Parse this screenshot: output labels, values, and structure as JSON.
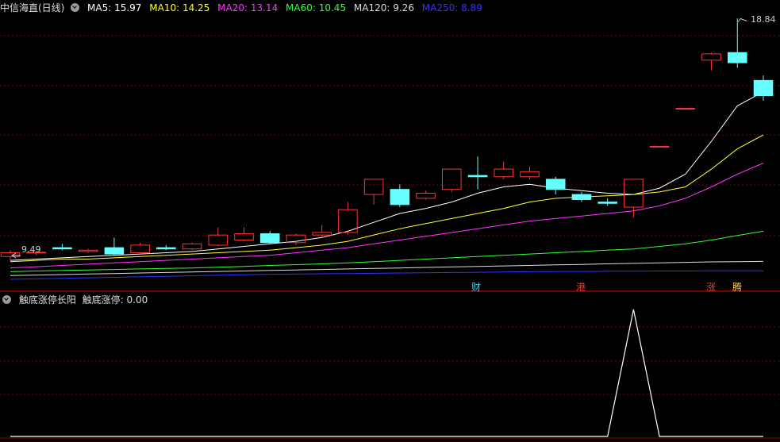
{
  "header": {
    "stock_name": "中信海直(日线)",
    "ma_labels": [
      {
        "text": "MA5: 15.97",
        "color": "#ffffff"
      },
      {
        "text": "MA10: 14.25",
        "color": "#ffff33"
      },
      {
        "text": "MA20: 13.14",
        "color": "#ff33ff"
      },
      {
        "text": "MA60: 10.45",
        "color": "#33ff33"
      },
      {
        "text": "MA120: 9.26",
        "color": "#dddddd"
      },
      {
        "text": "MA250: 8.89",
        "color": "#3333ff"
      }
    ]
  },
  "indicator_header": {
    "title": "触底涨停长阳",
    "value_label": "触底涨停: 0.00"
  },
  "price_labels": {
    "high": "18.84",
    "low": "9.49"
  },
  "event_tags": [
    {
      "text": "财",
      "color": "#33ccff"
    },
    {
      "text": "港",
      "color": "#ff3333"
    },
    {
      "text": "涨",
      "color": "#ff3333"
    },
    {
      "text": "腾",
      "color": "#ffcc66"
    }
  ],
  "colors": {
    "up": "#ff3333",
    "down": "#66ffff",
    "grid": "#7a0000"
  },
  "chart_data": [
    {
      "type": "candlestick",
      "ylim": [
        8.3,
        19.2
      ],
      "candles": [
        {
          "o": 9.45,
          "h": 9.7,
          "l": 9.3,
          "c": 9.6
        },
        {
          "o": 9.6,
          "h": 9.65,
          "l": 9.5,
          "c": 9.62
        },
        {
          "o": 9.8,
          "h": 9.95,
          "l": 9.7,
          "c": 9.75
        },
        {
          "o": 9.65,
          "h": 9.75,
          "l": 9.6,
          "c": 9.7
        },
        {
          "o": 9.8,
          "h": 10.2,
          "l": 9.5,
          "c": 9.55
        },
        {
          "o": 9.6,
          "h": 10.0,
          "l": 9.55,
          "c": 9.9
        },
        {
          "o": 9.8,
          "h": 9.9,
          "l": 9.7,
          "c": 9.75
        },
        {
          "o": 9.75,
          "h": 10.0,
          "l": 9.7,
          "c": 9.95
        },
        {
          "o": 9.9,
          "h": 10.6,
          "l": 9.85,
          "c": 10.3
        },
        {
          "o": 10.1,
          "h": 10.6,
          "l": 10.05,
          "c": 10.35
        },
        {
          "o": 10.35,
          "h": 10.45,
          "l": 9.95,
          "c": 10.0
        },
        {
          "o": 10.0,
          "h": 10.35,
          "l": 9.9,
          "c": 10.3
        },
        {
          "o": 10.3,
          "h": 10.7,
          "l": 10.2,
          "c": 10.4
        },
        {
          "o": 10.4,
          "h": 11.6,
          "l": 10.3,
          "c": 11.3
        },
        {
          "o": 11.9,
          "h": 12.0,
          "l": 11.5,
          "c": 12.5
        },
        {
          "o": 12.1,
          "h": 12.3,
          "l": 11.4,
          "c": 11.5
        },
        {
          "o": 11.75,
          "h": 12.05,
          "l": 11.7,
          "c": 11.95
        },
        {
          "o": 12.1,
          "h": 12.9,
          "l": 12.0,
          "c": 12.9
        },
        {
          "o": 12.65,
          "h": 13.4,
          "l": 12.1,
          "c": 12.6
        },
        {
          "o": 12.6,
          "h": 13.2,
          "l": 12.5,
          "c": 12.9
        },
        {
          "o": 12.6,
          "h": 13.0,
          "l": 12.5,
          "c": 12.8
        },
        {
          "o": 12.5,
          "h": 12.6,
          "l": 11.9,
          "c": 12.1
        },
        {
          "o": 11.9,
          "h": 12.0,
          "l": 11.6,
          "c": 11.7
        },
        {
          "o": 11.6,
          "h": 11.75,
          "l": 11.45,
          "c": 11.55
        },
        {
          "o": 11.4,
          "h": 11.3,
          "l": 11.0,
          "c": 12.5
        },
        {
          "o": 13.8,
          "h": 13.8,
          "l": 13.8,
          "c": 13.8
        },
        {
          "o": 15.3,
          "h": 15.3,
          "l": 15.3,
          "c": 15.3
        },
        {
          "o": 17.2,
          "h": 17.5,
          "l": 16.8,
          "c": 17.45
        },
        {
          "o": 17.5,
          "h": 18.85,
          "l": 16.9,
          "c": 17.1
        },
        {
          "o": 16.4,
          "h": 16.6,
          "l": 15.6,
          "c": 15.8
        }
      ],
      "moving_averages": [
        {
          "name": "MA5",
          "color": "#ffffff",
          "values": [
            9.3,
            9.35,
            9.4,
            9.45,
            9.5,
            9.55,
            9.6,
            9.65,
            9.75,
            9.85,
            9.95,
            10.05,
            10.2,
            10.45,
            10.8,
            11.15,
            11.35,
            11.6,
            11.95,
            12.2,
            12.3,
            12.15,
            12.05,
            11.95,
            11.9,
            12.15,
            12.7,
            14.0,
            15.4,
            15.95
          ]
        },
        {
          "name": "MA10",
          "color": "#ffff33",
          "values": [
            9.25,
            9.3,
            9.35,
            9.35,
            9.4,
            9.45,
            9.5,
            9.55,
            9.6,
            9.65,
            9.7,
            9.8,
            9.9,
            10.05,
            10.3,
            10.55,
            10.75,
            10.95,
            11.15,
            11.35,
            11.6,
            11.75,
            11.8,
            11.85,
            11.9,
            12.0,
            12.2,
            12.9,
            13.7,
            14.25
          ]
        },
        {
          "name": "MA20",
          "color": "#ff33ff",
          "values": [
            9.0,
            9.05,
            9.1,
            9.15,
            9.2,
            9.25,
            9.3,
            9.35,
            9.4,
            9.45,
            9.5,
            9.6,
            9.7,
            9.8,
            9.95,
            10.1,
            10.25,
            10.4,
            10.55,
            10.7,
            10.85,
            10.95,
            11.05,
            11.15,
            11.25,
            11.45,
            11.75,
            12.2,
            12.7,
            13.14
          ]
        },
        {
          "name": "MA60",
          "color": "#33ff33",
          "values": [
            8.85,
            8.88,
            8.9,
            8.92,
            8.94,
            8.96,
            8.98,
            9.0,
            9.03,
            9.06,
            9.1,
            9.13,
            9.16,
            9.2,
            9.25,
            9.3,
            9.35,
            9.4,
            9.45,
            9.5,
            9.55,
            9.6,
            9.65,
            9.7,
            9.75,
            9.85,
            9.95,
            10.1,
            10.28,
            10.45
          ]
        },
        {
          "name": "MA120",
          "color": "#dddddd",
          "values": [
            8.7,
            8.72,
            8.74,
            8.76,
            8.78,
            8.8,
            8.82,
            8.84,
            8.86,
            8.88,
            8.9,
            8.92,
            8.94,
            8.96,
            8.98,
            9.0,
            9.02,
            9.04,
            9.06,
            9.08,
            9.1,
            9.12,
            9.14,
            9.16,
            9.18,
            9.2,
            9.22,
            9.24,
            9.25,
            9.26
          ]
        },
        {
          "name": "MA250",
          "color": "#3333ff",
          "values": [
            8.55,
            8.57,
            8.59,
            8.61,
            8.63,
            8.65,
            8.67,
            8.69,
            8.71,
            8.73,
            8.75,
            8.76,
            8.77,
            8.78,
            8.79,
            8.8,
            8.81,
            8.82,
            8.83,
            8.84,
            8.85,
            8.86,
            8.86,
            8.87,
            8.87,
            8.88,
            8.88,
            8.89,
            8.89,
            8.89
          ]
        }
      ]
    },
    {
      "type": "line",
      "ylim": [
        0,
        1
      ],
      "values": [
        0,
        0,
        0,
        0,
        0,
        0,
        0,
        0,
        0,
        0,
        0,
        0,
        0,
        0,
        0,
        0,
        0,
        0,
        0,
        0,
        0,
        0,
        0,
        0,
        1,
        0,
        0,
        0,
        0,
        0
      ]
    }
  ]
}
